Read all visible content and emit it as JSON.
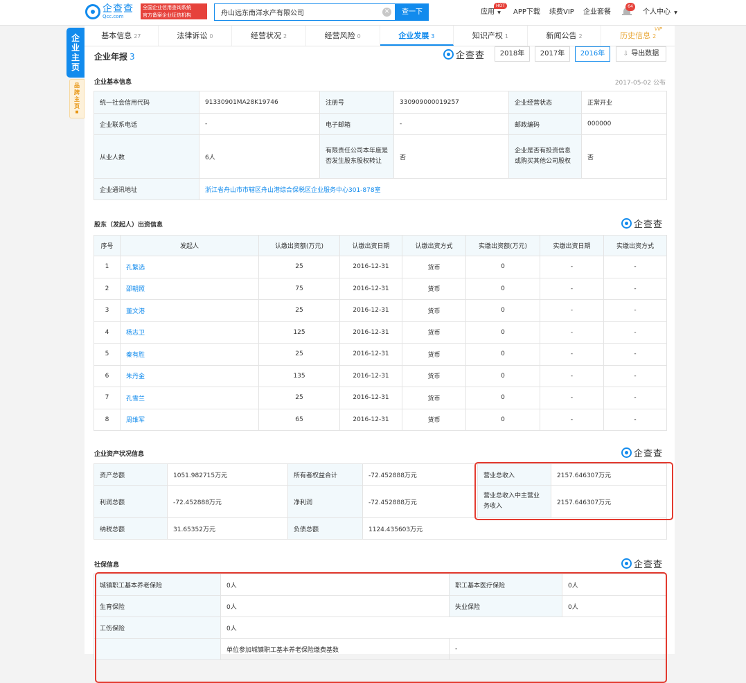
{
  "header": {
    "logo_name": "企查查",
    "logo_sub": "Qcc.com",
    "slogan_line1": "全国企业信用查询系统",
    "slogan_line2": "官方备案企业征信机构",
    "search_value": "舟山远东南洋水产有限公司",
    "search_clear": "✕",
    "search_button": "查一下",
    "nav": {
      "app": "应用",
      "hot": "HOT",
      "app_download": "APP下载",
      "renew_vip": "续费VIP",
      "enterprise_package": "企业套餐",
      "notification_count": "64",
      "user_center": "个人中心"
    }
  },
  "side": {
    "main_tab": [
      "企",
      "业",
      "主",
      "页"
    ],
    "brand_tab": [
      "品",
      "牌",
      "主",
      "页"
    ],
    "brand_dot": "■"
  },
  "tabs": [
    {
      "label": "基本信息",
      "count": "27"
    },
    {
      "label": "法律诉讼",
      "count": "0"
    },
    {
      "label": "经营状况",
      "count": "2"
    },
    {
      "label": "经营风险",
      "count": "0"
    },
    {
      "label": "企业发展",
      "count": "3"
    },
    {
      "label": "知识产权",
      "count": "1"
    },
    {
      "label": "新闻公告",
      "count": "2"
    },
    {
      "label": "历史信息",
      "count": "2",
      "vip": "VIP"
    }
  ],
  "report": {
    "title": "企业年报",
    "count": "3",
    "watermark": "企查查",
    "years": [
      "2018年",
      "2017年",
      "2016年"
    ],
    "active_year": "2016年",
    "export": "导出数据",
    "export_icon": "⇩"
  },
  "basic": {
    "title": "企业基本信息",
    "published": "2017-05-02 公布",
    "credit_code_label": "统一社会信用代码",
    "credit_code": "91330901MA28K19746",
    "reg_no_label": "注册号",
    "reg_no": "330909000019257",
    "status_label": "企业经营状态",
    "status": "正常开业",
    "phone_label": "企业联系电话",
    "phone": "-",
    "email_label": "电子邮箱",
    "email": "-",
    "postcode_label": "邮政编码",
    "postcode": "000000",
    "employees_label": "从业人数",
    "employees": "6人",
    "equity_transfer_label": "有限责任公司本年度是否发生股东股权转让",
    "equity_transfer": "否",
    "investment_label": "企业是否有投资信息或购买其他公司股权",
    "investment": "否",
    "address_label": "企业通讯地址",
    "address": "浙江省舟山市市辖区舟山港综合保税区企业服务中心301-878室"
  },
  "holders": {
    "title": "股东（发起人）出资信息",
    "columns": [
      "序号",
      "发起人",
      "认缴出资额(万元)",
      "认缴出资日期",
      "认缴出资方式",
      "实缴出资额(万元)",
      "实缴出资日期",
      "实缴出资方式"
    ],
    "rows": [
      [
        "1",
        "孔繁选",
        "25",
        "2016-12-31",
        "货币",
        "0",
        "-",
        "-"
      ],
      [
        "2",
        "邵朝照",
        "75",
        "2016-12-31",
        "货币",
        "0",
        "-",
        "-"
      ],
      [
        "3",
        "董文港",
        "25",
        "2016-12-31",
        "货币",
        "0",
        "-",
        "-"
      ],
      [
        "4",
        "杨志卫",
        "125",
        "2016-12-31",
        "货币",
        "0",
        "-",
        "-"
      ],
      [
        "5",
        "秦有胜",
        "25",
        "2016-12-31",
        "货币",
        "0",
        "-",
        "-"
      ],
      [
        "6",
        "朱丹金",
        "135",
        "2016-12-31",
        "货币",
        "0",
        "-",
        "-"
      ],
      [
        "7",
        "孔雪兰",
        "25",
        "2016-12-31",
        "货币",
        "0",
        "-",
        "-"
      ],
      [
        "8",
        "周维军",
        "65",
        "2016-12-31",
        "货币",
        "0",
        "-",
        "-"
      ]
    ]
  },
  "assets": {
    "title": "企业资产状况信息",
    "total_assets_label": "资产总额",
    "total_assets": "1051.982715万元",
    "equity_label": "所有者权益合计",
    "equity": "-72.452888万元",
    "revenue_label": "营业总收入",
    "revenue": "2157.646307万元",
    "profit_label": "利润总额",
    "profit": "-72.452888万元",
    "net_profit_label": "净利润",
    "net_profit": "-72.452888万元",
    "main_revenue_label": "营业总收入中主营业务收入",
    "main_revenue": "2157.646307万元",
    "tax_label": "纳税总额",
    "tax": "31.65352万元",
    "debt_label": "负债总额",
    "debt": "1124.435603万元"
  },
  "social": {
    "title": "社保信息",
    "pension_label": "城镇职工基本养老保险",
    "pension": "0人",
    "medical_label": "职工基本医疗保险",
    "medical": "0人",
    "maternity_label": "生育保险",
    "maternity": "0人",
    "unemployment_label": "失业保险",
    "unemployment": "0人",
    "injury_label": "工伤保险",
    "injury": "0人",
    "base_label": "单位参加城镇职工基本养老保险缴费基数",
    "base": "-"
  },
  "colors": {
    "accent": "#128bed",
    "highlight": "#e33a2f",
    "vip": "#e9a83a"
  }
}
